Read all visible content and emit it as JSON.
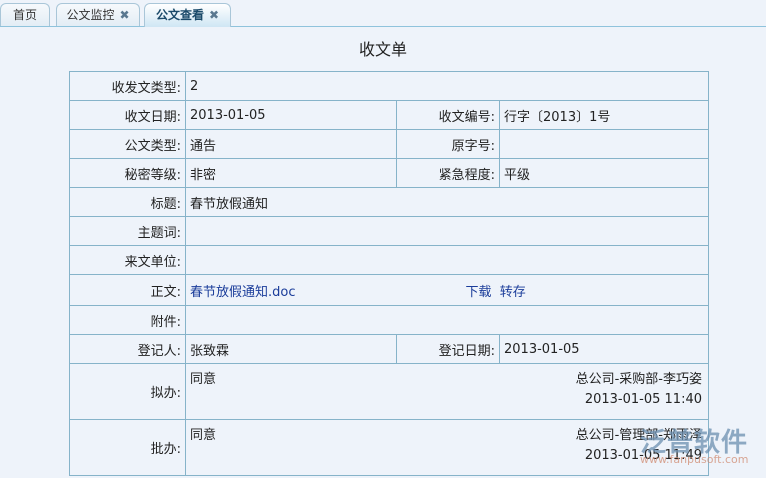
{
  "tabs": [
    {
      "label": "首页"
    },
    {
      "label": "公文监控",
      "close": "✖"
    },
    {
      "label": "公文查看",
      "close": "✖"
    }
  ],
  "title": "收文单",
  "fields": {
    "type_label": "收发文类型:",
    "type": "2",
    "date_label": "收文日期:",
    "date": "2013-01-05",
    "number_label": "收文编号:",
    "number": "行字〔2013〕1号",
    "doc_type_label": "公文类型:",
    "doc_type": "通告",
    "orig_label": "原字号:",
    "orig": "",
    "secret_label": "秘密等级:",
    "secret": "非密",
    "urgent_label": "紧急程度:",
    "urgent": "平级",
    "subject_label": "标题:",
    "subject": "春节放假通知",
    "keywords_label": "主题词:",
    "keywords": "",
    "from_label": "来文单位:",
    "from": "",
    "body_label": "正文:",
    "body_file": "春节放假通知.doc",
    "download": "下载",
    "save": "转存",
    "attach_label": "附件:",
    "attach": "",
    "reg_label": "登记人:",
    "reg": "张致霖",
    "reg_date_label": "登记日期:",
    "reg_date": "2013-01-05"
  },
  "draft": {
    "label": "拟办:",
    "opinion": "同意",
    "by": "总公司-采购部-李巧姿",
    "time": "2013-01-05 11:40"
  },
  "approve": {
    "label": "批办:",
    "opinion": "同意",
    "by": "总公司-管理部-郑雨泽",
    "time": "2013-01-05 11:49"
  },
  "watermark": {
    "brand": "泛普软件",
    "url": "www.fanpusoft.com"
  }
}
